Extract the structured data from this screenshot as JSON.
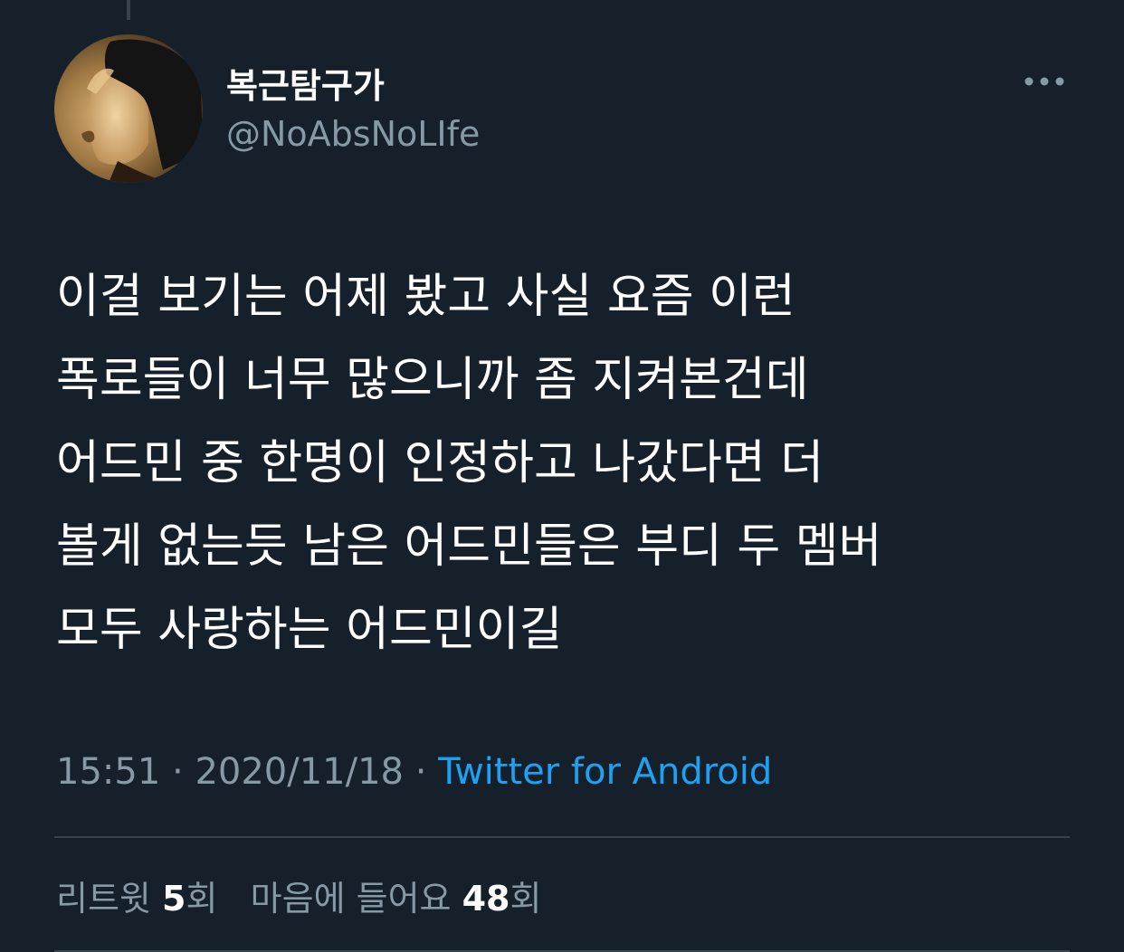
{
  "user": {
    "display_name": "복근탐구가",
    "handle": "@NoAbsNoLIfe"
  },
  "menu": {
    "icon": "more-horizontal-icon"
  },
  "tweet": {
    "lines": [
      "이걸 보기는 어제 봤고 사실 요즘 이런",
      "폭로들이 너무 많으니까 좀 지켜본건데",
      "어드민 중 한명이 인정하고 나갔다면 더",
      "볼게 없는듯 남은 어드민들은 부디 두 멤버",
      "모두 사랑하는 어드민이길"
    ]
  },
  "meta": {
    "time": "15:51",
    "separator": "·",
    "date": "2020/11/18",
    "source": "Twitter for Android"
  },
  "stats": {
    "retweets_label": "리트윗",
    "retweets_count": "5",
    "retweets_unit": "회",
    "likes_label": "마음에 들어요",
    "likes_count": "48",
    "likes_unit": "회"
  },
  "colors": {
    "background": "#15202b",
    "secondary_text": "#8899a6",
    "link": "#1da1f2",
    "divider": "#38444d"
  }
}
